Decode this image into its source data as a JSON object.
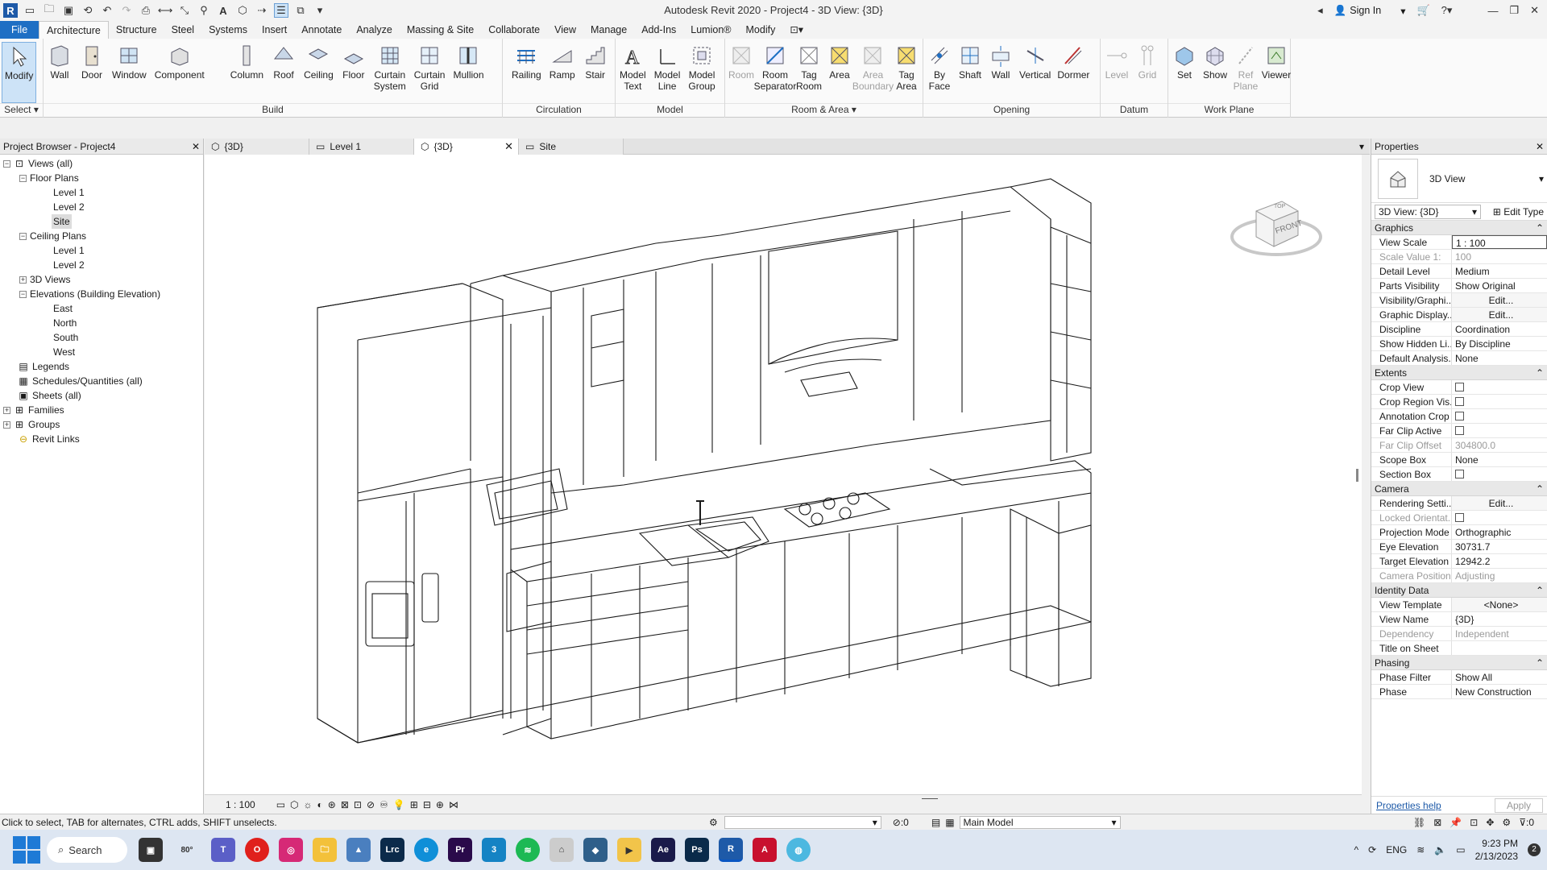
{
  "window": {
    "title": "Autodesk Revit 2020 - Project4 - 3D View: {3D}",
    "sign_in": "Sign In"
  },
  "menu": [
    "File",
    "Architecture",
    "Structure",
    "Steel",
    "Systems",
    "Insert",
    "Annotate",
    "Analyze",
    "Massing & Site",
    "Collaborate",
    "View",
    "Manage",
    "Add-Ins",
    "Lumion®",
    "Modify"
  ],
  "ribbon": {
    "select": {
      "tool": "Modify",
      "title": "Select"
    },
    "build": {
      "title": "Build",
      "tools": [
        "Wall",
        "Door",
        "Window",
        "Component",
        "Column",
        "Roof",
        "Ceiling",
        "Floor",
        "Curtain\nSystem",
        "Curtain\nGrid",
        "Mullion"
      ]
    },
    "circulation": {
      "title": "Circulation",
      "tools": [
        "Railing",
        "Ramp",
        "Stair"
      ]
    },
    "model": {
      "title": "Model",
      "tools": [
        "Model\nText",
        "Model\nLine",
        "Model\nGroup"
      ]
    },
    "room": {
      "title": "Room & Area",
      "tools": [
        "Room",
        "Room\nSeparator",
        "Tag\nRoom",
        "Area",
        "Area\nBoundary",
        "Tag\nArea"
      ]
    },
    "opening": {
      "title": "Opening",
      "tools": [
        "By\nFace",
        "Shaft",
        "Wall",
        "Vertical",
        "Dormer"
      ]
    },
    "datum": {
      "title": "Datum",
      "tools": [
        "Level",
        "Grid"
      ]
    },
    "workplane": {
      "title": "Work Plane",
      "tools": [
        "Set",
        "Show",
        "Ref\nPlane",
        "Viewer"
      ]
    }
  },
  "browser": {
    "title": "Project Browser - Project4",
    "items": [
      "Views (all)",
      "Floor Plans",
      "Level 1",
      "Level 2",
      "Site",
      "Ceiling Plans",
      "Level 1",
      "Level 2",
      "3D Views",
      "Elevations (Building Elevation)",
      "East",
      "North",
      "South",
      "West",
      "Legends",
      "Schedules/Quantities (all)",
      "Sheets (all)",
      "Families",
      "Groups",
      "Revit Links"
    ]
  },
  "view_tabs": [
    "{3D}",
    "Level 1",
    "{3D}",
    "Site"
  ],
  "viewcube": {
    "top": "TOP",
    "front": "FRONT"
  },
  "view_control": {
    "scale": "1 : 100"
  },
  "properties": {
    "title": "Properties",
    "type": "3D View",
    "selector": "3D View: {3D}",
    "edit_type": "Edit Type",
    "groups": [
      {
        "name": "Graphics",
        "rows": [
          [
            "View Scale",
            "1 : 100"
          ],
          [
            "Scale Value   1:",
            "100"
          ],
          [
            "Detail Level",
            "Medium"
          ],
          [
            "Parts Visibility",
            "Show Original"
          ],
          [
            "Visibility/Graphi...",
            "Edit..."
          ],
          [
            "Graphic Display...",
            "Edit..."
          ],
          [
            "Discipline",
            "Coordination"
          ],
          [
            "Show Hidden Li...",
            "By Discipline"
          ],
          [
            "Default Analysis...",
            "None"
          ]
        ]
      },
      {
        "name": "Extents",
        "rows": [
          [
            "Crop View",
            ""
          ],
          [
            "Crop Region Vis...",
            ""
          ],
          [
            "Annotation Crop",
            ""
          ],
          [
            "Far Clip Active",
            ""
          ],
          [
            "Far Clip Offset",
            "304800.0"
          ],
          [
            "Scope Box",
            "None"
          ],
          [
            "Section Box",
            ""
          ]
        ]
      },
      {
        "name": "Camera",
        "rows": [
          [
            "Rendering Setti...",
            "Edit..."
          ],
          [
            "Locked Orientat...",
            ""
          ],
          [
            "Projection Mode",
            "Orthographic"
          ],
          [
            "Eye Elevation",
            "30731.7"
          ],
          [
            "Target Elevation",
            "12942.2"
          ],
          [
            "Camera Position",
            "Adjusting"
          ]
        ]
      },
      {
        "name": "Identity Data",
        "rows": [
          [
            "View Template",
            "<None>"
          ],
          [
            "View Name",
            "{3D}"
          ],
          [
            "Dependency",
            "Independent"
          ],
          [
            "Title on Sheet",
            ""
          ]
        ]
      },
      {
        "name": "Phasing",
        "rows": [
          [
            "Phase Filter",
            "Show All"
          ],
          [
            "Phase",
            "New Construction"
          ]
        ]
      }
    ],
    "help": "Properties help",
    "apply": "Apply"
  },
  "status": {
    "hint": "Click to select, TAB for alternates, CTRL adds, SHIFT unselects.",
    "zero": ":0",
    "model": "Main Model",
    "filter": ":0"
  },
  "taskbar": {
    "search": "Search",
    "temp": "80°",
    "lang": "ENG",
    "time": "9:23 PM",
    "date": "2/13/2023",
    "badge": "2"
  }
}
